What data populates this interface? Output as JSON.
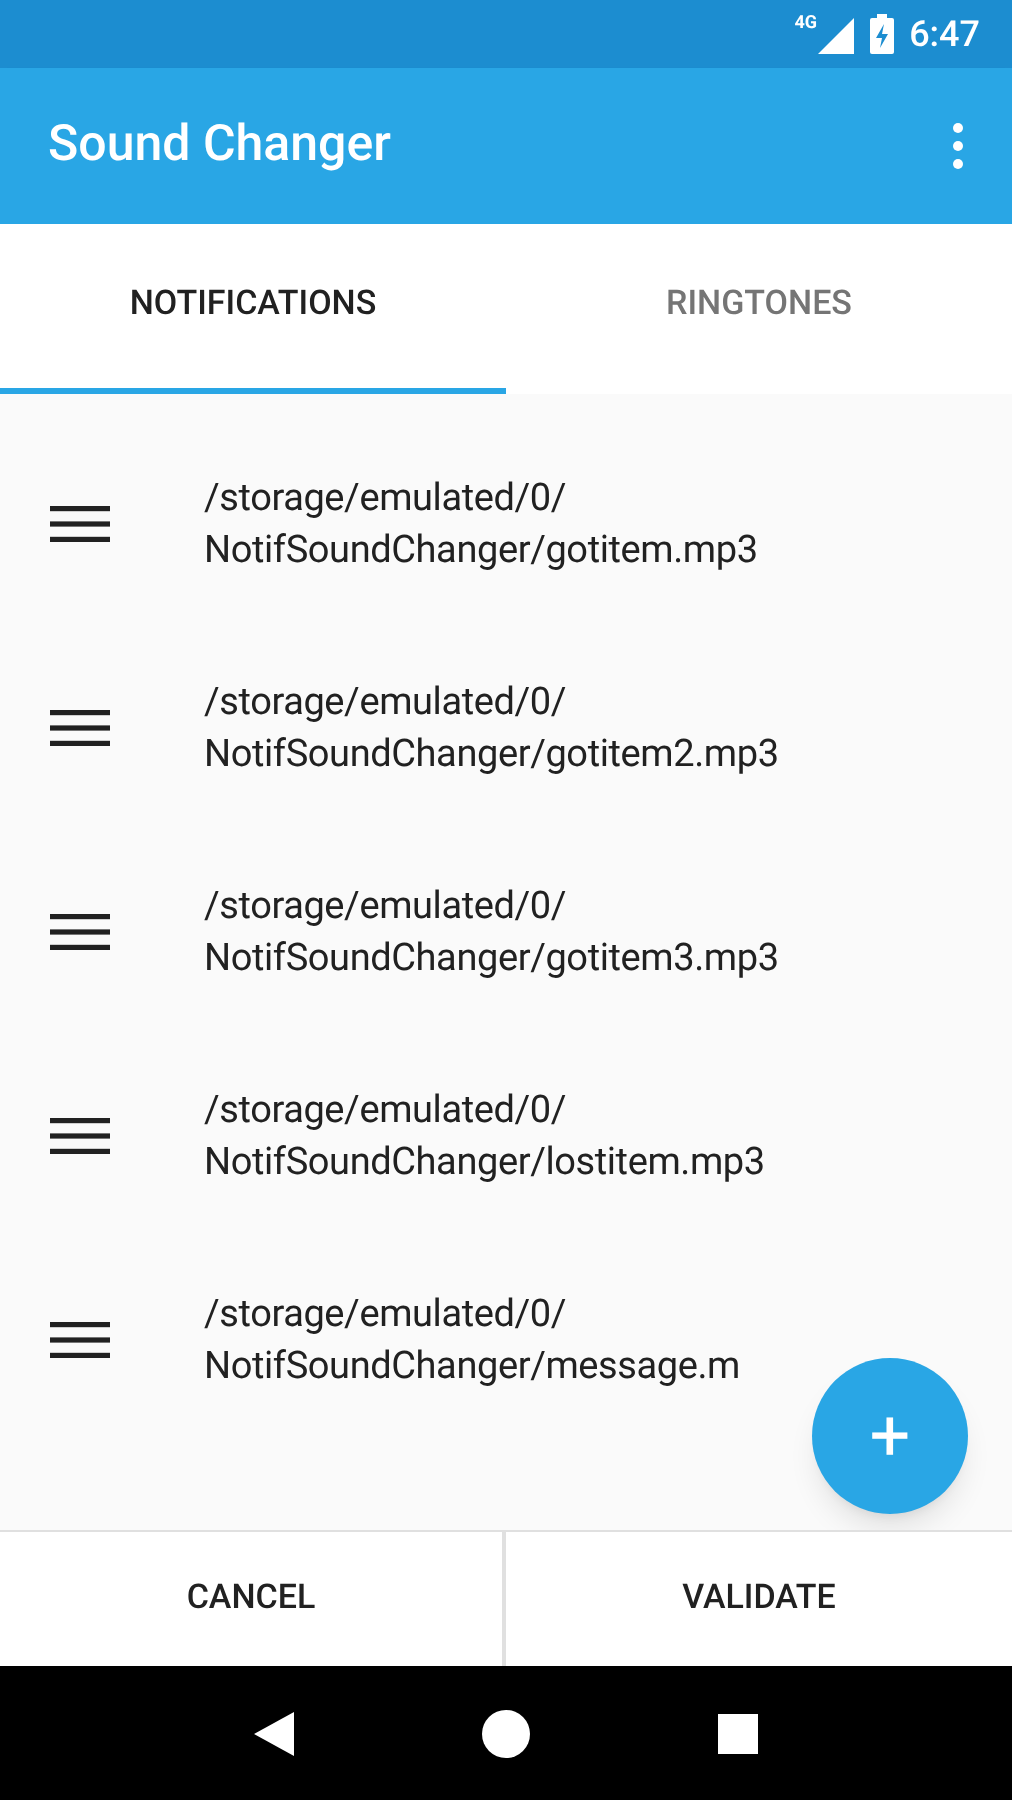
{
  "status_bar": {
    "network": "4G",
    "time": "6:47"
  },
  "app_bar": {
    "title": "Sound Changer"
  },
  "tabs": [
    {
      "label": "NOTIFICATIONS",
      "selected": true
    },
    {
      "label": "RINGTONES",
      "selected": false
    }
  ],
  "items": [
    {
      "line_1": "/storage/emulated/0/",
      "line_2": "NotifSoundChanger/gotitem.mp3"
    },
    {
      "line_1": "/storage/emulated/0/",
      "line_2": "NotifSoundChanger/gotitem2.mp3"
    },
    {
      "line_1": "/storage/emulated/0/",
      "line_2": "NotifSoundChanger/gotitem3.mp3"
    },
    {
      "line_1": "/storage/emulated/0/",
      "line_2": "NotifSoundChanger/lostitem.mp3"
    },
    {
      "line_1": "/storage/emulated/0/",
      "line_2": "NotifSoundChanger/message.m"
    }
  ],
  "fab": {
    "label": "+"
  },
  "buttons": [
    "CANCEL",
    "VALIDATE"
  ]
}
